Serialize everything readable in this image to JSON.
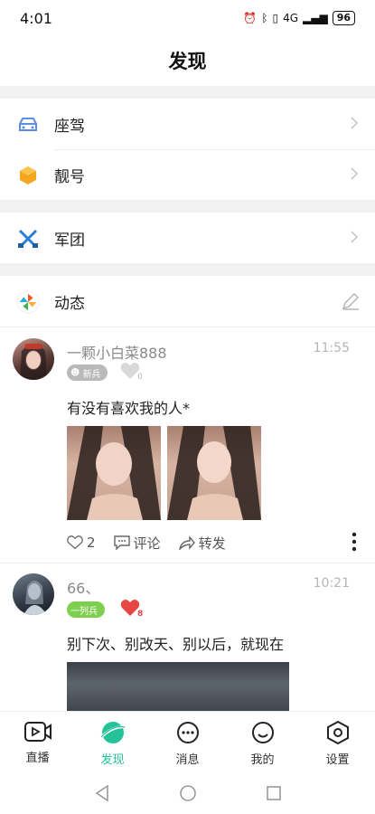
{
  "status_bar": {
    "time": "4:01",
    "network": "4G",
    "battery": "96"
  },
  "page": {
    "title": "发现"
  },
  "menu": {
    "items": [
      {
        "label": "座驾",
        "icon": "car-icon"
      },
      {
        "label": "靓号",
        "icon": "gem-icon"
      },
      {
        "label": "军团",
        "icon": "crossed-guns-icon"
      },
      {
        "label": "动态",
        "icon": "pinwheel-icon"
      }
    ]
  },
  "feed": {
    "posts": [
      {
        "username": "一颗小白菜888",
        "time": "11:55",
        "badge": "新兵",
        "badge_color": "#b9b9b9",
        "like_count_small": "0",
        "text": "有没有喜欢我的人*",
        "likes": "2",
        "comment_label": "评论",
        "share_label": "转发"
      },
      {
        "username": "66、",
        "time": "10:21",
        "badge": "一列兵",
        "badge_color": "#7fcf4f",
        "like_count_small": "8",
        "text": "别下次、别改天、别以后，就现在"
      }
    ]
  },
  "tabs": [
    {
      "label": "直播",
      "icon": "live-play-icon"
    },
    {
      "label": "发现",
      "icon": "discover-planet-icon"
    },
    {
      "label": "消息",
      "icon": "message-icon"
    },
    {
      "label": "我的",
      "icon": "smile-icon"
    },
    {
      "label": "设置",
      "icon": "settings-hex-icon"
    }
  ],
  "colors": {
    "accent": "#25c29a",
    "separator": "#f2f2f2",
    "heart_red": "#e84545"
  }
}
